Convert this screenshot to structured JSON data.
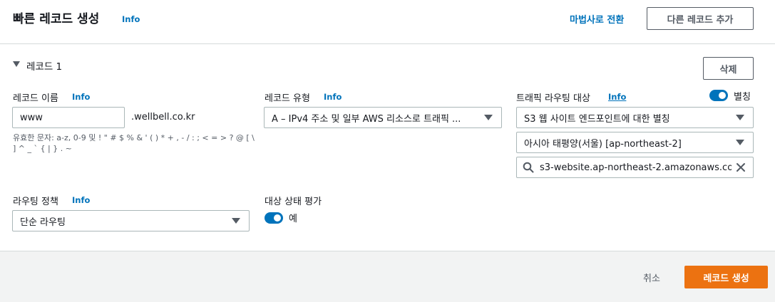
{
  "header": {
    "title": "빠른 레코드 생성",
    "info": "Info",
    "wizard_link": "마법사로 전환",
    "add_record_button": "다른 레코드 추가"
  },
  "record": {
    "heading": "레코드 1",
    "delete_button": "삭제",
    "name": {
      "label": "레코드 이름",
      "info": "Info",
      "value": "www",
      "suffix": ".wellbell.co.kr",
      "hint_line1": "유효한 문자: a-z, 0-9 및 ! \" # $ % & ' ( ) * + , - / : ; < = > ? @ [ \\",
      "hint_line2": "] ^ _ ` { | } . ~"
    },
    "type": {
      "label": "레코드 유형",
      "info": "Info",
      "value": "A – IPv4 주소 및 일부 AWS 리소스로 트래픽 ..."
    },
    "target": {
      "label": "트래픽 라우팅 대상",
      "info": "Info",
      "alias_label": "별칭",
      "alias_on": true,
      "endpoint_select": "S3 웹 사이트 엔드포인트에 대한 별칭",
      "region_select": "아시아 태평양(서울) [ap-northeast-2]",
      "search_value": "s3-website.ap-northeast-2.amazonaws.co"
    },
    "policy": {
      "label": "라우팅 정책",
      "info": "Info",
      "value": "단순 라우팅"
    },
    "health": {
      "label": "대상 상태 평가",
      "toggle_label": "예",
      "toggle_on": true
    }
  },
  "footer": {
    "cancel": "취소",
    "create": "레코드 생성"
  },
  "colors": {
    "accent": "#0073bb",
    "primary_button": "#ec7211",
    "page_bg": "#f2f3f3"
  }
}
